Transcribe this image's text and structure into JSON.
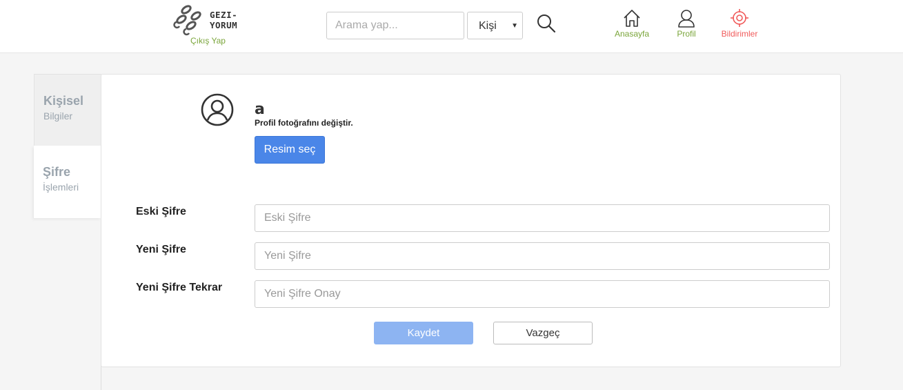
{
  "header": {
    "logo_line1": "GEZI-",
    "logo_line2": "YORUM",
    "logout_label": "Çıkış Yap",
    "search_placeholder": "Arama yap...",
    "search_type_selected": "Kişi",
    "nav": {
      "home": "Anasayfa",
      "profile": "Profil",
      "notifications": "Bildirimler"
    }
  },
  "colors": {
    "accent_green": "#7aa53a",
    "accent_red": "#f05a5a",
    "primary_blue": "#4a86e8"
  },
  "sidebar": {
    "tabs": [
      {
        "title": "Kişisel",
        "subtitle": "Bilgiler"
      },
      {
        "title": "Şifre",
        "subtitle": "İşlemleri"
      }
    ]
  },
  "profile": {
    "username": "a",
    "change_photo_label": "Profil fotoğrafını değiştir.",
    "choose_image_button": "Resim seç"
  },
  "form": {
    "old_password": {
      "label": "Eski Şifre",
      "placeholder": "Eski Şifre"
    },
    "new_password": {
      "label": "Yeni Şifre",
      "placeholder": "Yeni Şifre"
    },
    "confirm_password": {
      "label": "Yeni Şifre Tekrar",
      "placeholder": "Yeni Şifre Onay"
    },
    "save_button": "Kaydet",
    "cancel_button": "Vazgeç"
  }
}
